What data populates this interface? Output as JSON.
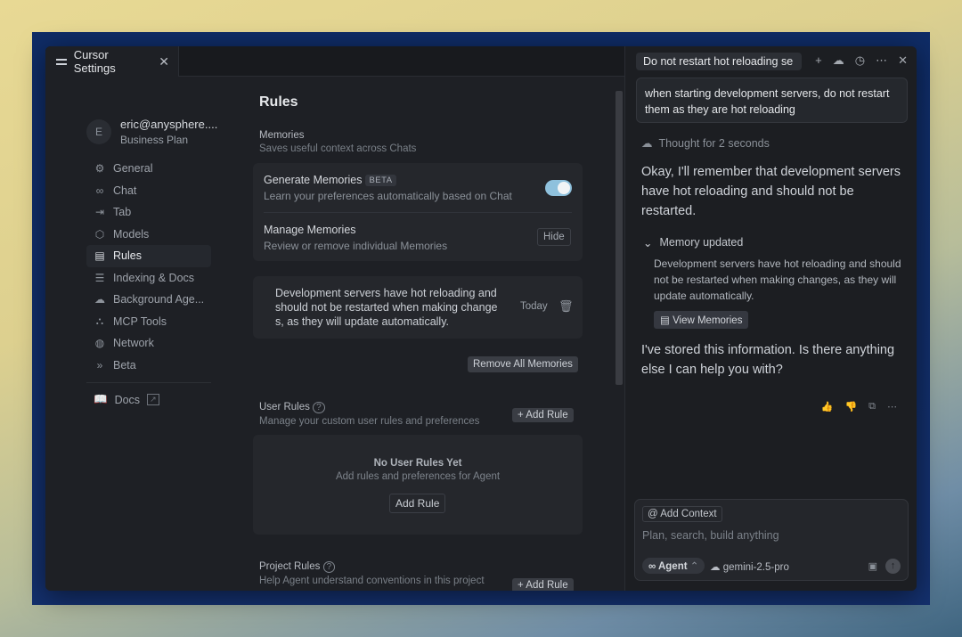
{
  "settings_tab": {
    "title": "Cursor Settings",
    "close": "✕"
  },
  "profile": {
    "initial": "E",
    "email": "eric@anysphere....",
    "plan": "Business Plan"
  },
  "nav": {
    "items": [
      {
        "label": "General",
        "icon": "⚙"
      },
      {
        "label": "Chat",
        "icon": "∞"
      },
      {
        "label": "Tab",
        "icon": "⇥"
      },
      {
        "label": "Models",
        "icon": "⬡"
      },
      {
        "label": "Rules",
        "icon": "▤"
      },
      {
        "label": "Indexing & Docs",
        "icon": "☰"
      },
      {
        "label": "Background Age...",
        "icon": "☁"
      },
      {
        "label": "MCP Tools",
        "icon": "⛬"
      },
      {
        "label": "Network",
        "icon": "◍"
      },
      {
        "label": "Beta",
        "icon": "»"
      }
    ],
    "docs": "Docs"
  },
  "rules": {
    "title": "Rules",
    "memories": {
      "title": "Memories",
      "subtitle": "Saves useful context across Chats",
      "generate_title": "Generate Memories",
      "beta": "BETA",
      "generate_sub": "Learn your preferences automatically based on Chat",
      "manage_title": "Manage Memories",
      "manage_sub": "Review or remove individual Memories",
      "hide": "Hide",
      "item_text": "Development servers have hot reloading and should not be restarted when making change s, as they will update automatically.",
      "item_date": "Today",
      "remove_all": "Remove All Memories"
    },
    "user_rules": {
      "title": "User Rules",
      "subtitle": "Manage your custom user rules and preferences",
      "add": "Add Rule",
      "empty_title": "No User Rules Yet",
      "empty_sub": "Add rules and preferences for Agent",
      "empty_btn": "Add Rule"
    },
    "project_rules": {
      "title": "Project Rules",
      "subtitle": "Help Agent understand conventions in this project",
      "add": "Add Rule"
    }
  },
  "chat": {
    "tab_title": "Do not restart hot reloading se",
    "user_message": "when starting development servers, do not restart them as they are hot reloading",
    "thought": "Thought for 2 seconds",
    "answer1": "Okay, I'll remember that development servers have hot reloading and should not be restarted.",
    "memory_updated": "Memory updated",
    "memory_body": "Development servers have hot reloading and should not be restarted when making changes, as they will update automatically.",
    "view_memories": "View Memories",
    "answer2": "I've stored this information. Is there anything else I can help you with?",
    "composer": {
      "add_context": "Add Context",
      "placeholder": "Plan, search, build anything",
      "agent": "Agent",
      "model": "gemini-2.5-pro"
    }
  }
}
